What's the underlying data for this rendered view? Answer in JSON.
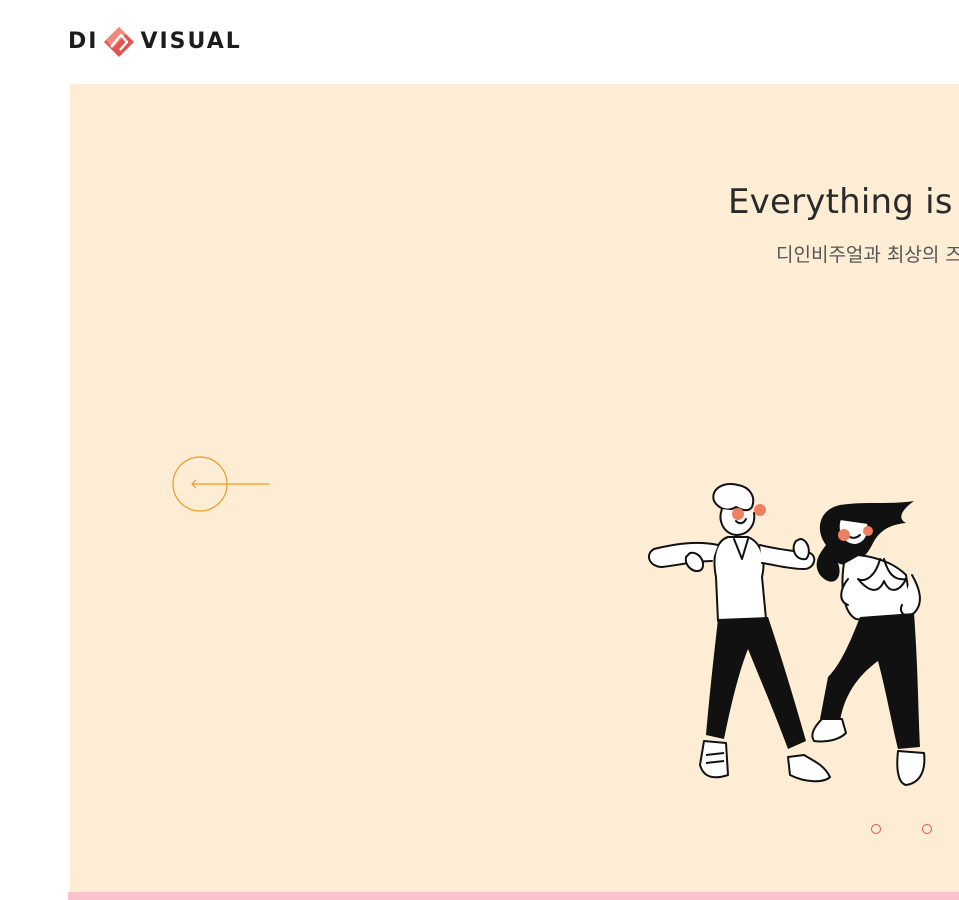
{
  "brand": {
    "left": "DI",
    "right": "VISUAL",
    "mark_colors": [
      "#e2554f",
      "#f08a7f"
    ]
  },
  "hero": {
    "title": "Everything is go",
    "subtitle": "디인비주얼과 최상의 즈",
    "background_color": "#fdedd5",
    "prev_arrow_icon": "arrow-left-circle-icon",
    "accent_color": "#f29a22"
  },
  "pagination": {
    "dot_color": "#e2554f",
    "dots": [
      "slide-1",
      "slide-2"
    ]
  },
  "footer_strip_color": "#f9c2cc"
}
